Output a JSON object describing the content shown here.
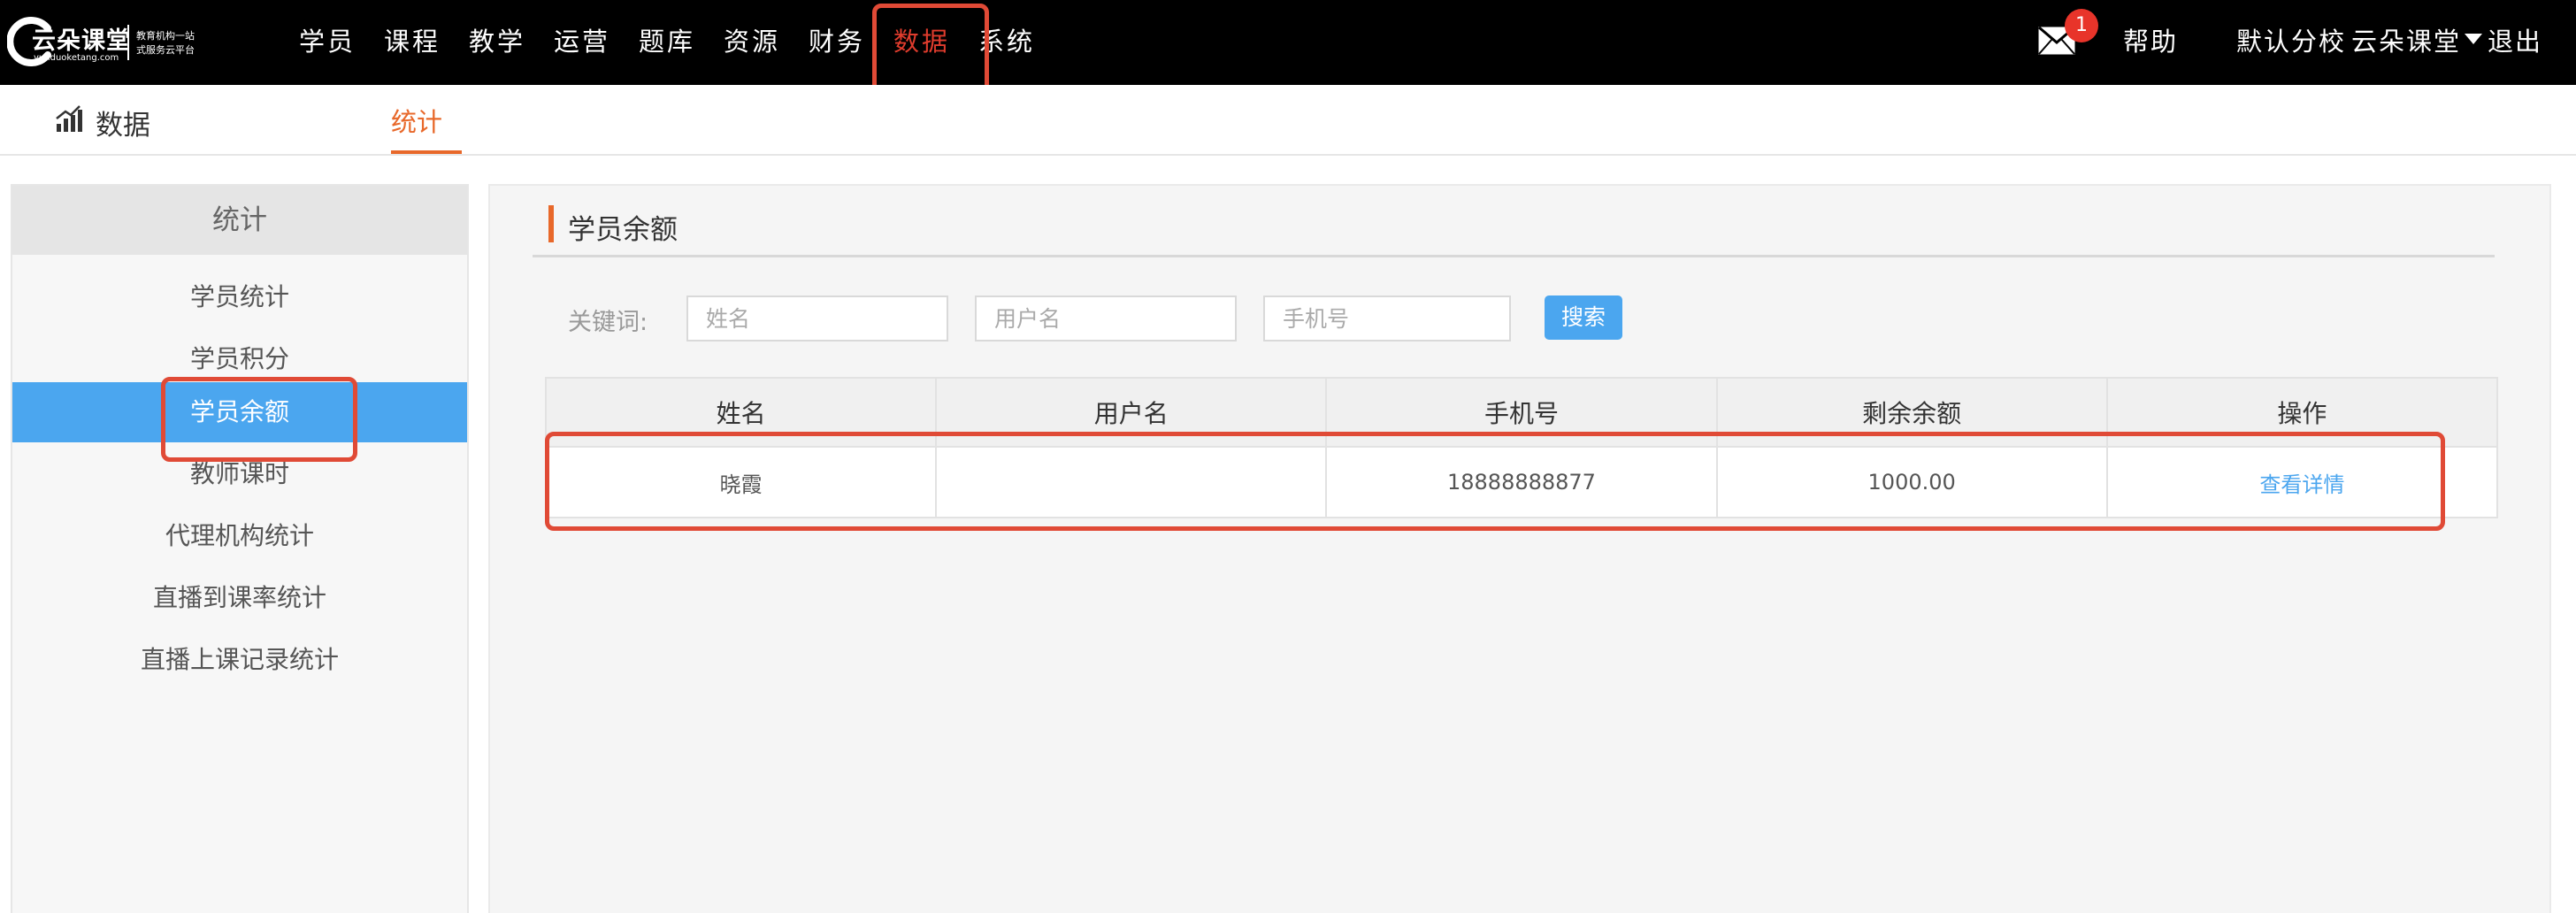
{
  "brand": {
    "name": "云朵课堂",
    "domain": "yunduoketang.com",
    "tagline_1": "教育机构一站",
    "tagline_2": "式服务云平台"
  },
  "nav": {
    "items": [
      {
        "label": "学员"
      },
      {
        "label": "课程"
      },
      {
        "label": "教学"
      },
      {
        "label": "运营"
      },
      {
        "label": "题库"
      },
      {
        "label": "资源"
      },
      {
        "label": "财务"
      },
      {
        "label": "数据",
        "active": true
      },
      {
        "label": "系统"
      }
    ],
    "mail_badge": "1",
    "help": "帮助",
    "campus": "默认分校",
    "org": "云朵课堂",
    "logout": "退出"
  },
  "subbar": {
    "section": "数据",
    "tab": "统计"
  },
  "sidebar": {
    "header": "统计",
    "items": [
      {
        "label": "学员统计"
      },
      {
        "label": "学员积分"
      },
      {
        "label": "学员余额",
        "active": true
      },
      {
        "label": "教师课时"
      },
      {
        "label": "代理机构统计"
      },
      {
        "label": "直播到课率统计"
      },
      {
        "label": "直播上课记录统计"
      }
    ]
  },
  "panel": {
    "title": "学员余额",
    "keyword_label": "关键词:",
    "name_placeholder": "姓名",
    "username_placeholder": "用户名",
    "phone_placeholder": "手机号",
    "search_label": "搜索"
  },
  "table": {
    "columns": [
      "姓名",
      "用户名",
      "手机号",
      "剩余余额",
      "操作"
    ],
    "rows": [
      {
        "name": "晓霞",
        "username": "",
        "phone": "18888888877",
        "balance": "1000.00",
        "action": "查看详情"
      }
    ]
  },
  "colors": {
    "accent_orange": "#e8682a",
    "primary_blue": "#4ba6ef",
    "highlight_red": "#e04a36"
  },
  "icons": [
    "mail-icon",
    "chart-icon",
    "caret-down-icon",
    "cloud-logo-icon"
  ]
}
